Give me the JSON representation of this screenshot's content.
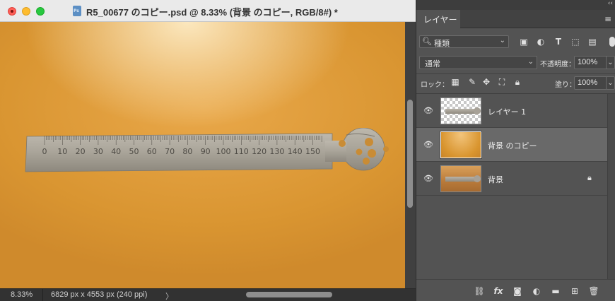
{
  "document": {
    "title": "R5_00677 のコピー.psd @ 8.33% (背景 のコピー, RGB/8#) *",
    "zoom": "8.33%",
    "info": "6829 px x 4553 px (240 ppi)",
    "arrow": "〉",
    "ruler_labels": [
      "0",
      "10",
      "20",
      "30",
      "40",
      "50",
      "60",
      "70",
      "80",
      "90",
      "100",
      "110",
      "120",
      "130",
      "140",
      "150"
    ]
  },
  "panel": {
    "collapse": "‹‹",
    "tab_label": "レイヤー",
    "menu_icon": "≡",
    "search_value": "種類",
    "blend_mode": "通常",
    "opacity_label": "不透明度：",
    "opacity_value": "100%",
    "lock_label": "ロック：",
    "fill_label": "塗り：",
    "fill_value": "100%",
    "layers": [
      {
        "name": "レイヤー 1",
        "thumb": "checker"
      },
      {
        "name": "背景 のコピー",
        "thumb": "orange",
        "selected": true
      },
      {
        "name": "背景",
        "thumb": "wood",
        "locked": true
      }
    ]
  },
  "icons": {
    "eye": "eye-icon",
    "search": "search-icon",
    "lock": "lock-icon",
    "link": "link-icon",
    "fx": "fx-icon",
    "mask": "mask-icon",
    "adjustment": "adjustment-icon",
    "folder": "folder-icon",
    "new_layer": "new-layer-icon",
    "trash": "trash-icon"
  },
  "colors": {
    "canvas": "#d99531",
    "panel": "#535353",
    "selected_layer": "#696969"
  }
}
